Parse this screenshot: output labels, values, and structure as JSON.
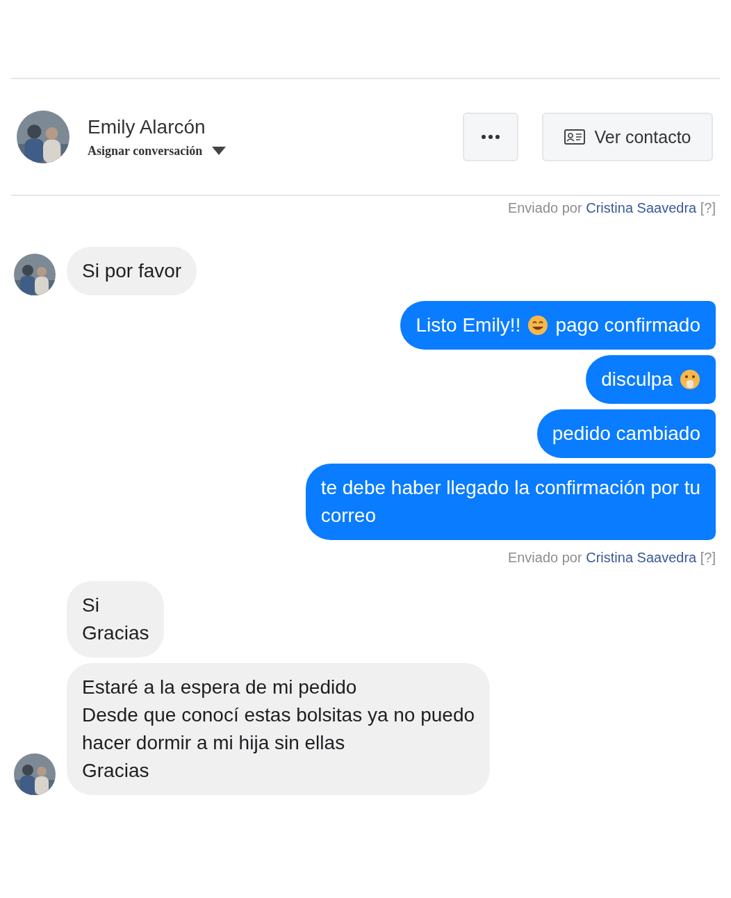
{
  "header": {
    "name": "Emily Alarcón",
    "assign_label": "Asignar conversación",
    "contact_button": "Ver contacto"
  },
  "messages": [
    {
      "kind": "sent_by",
      "prefix": "Enviado por",
      "agent": "Cristina Saavedra",
      "help": "[?]"
    },
    {
      "kind": "incoming",
      "avatar": true,
      "parts": [
        {
          "kind": "text",
          "text": "Si por favor"
        }
      ]
    },
    {
      "kind": "outgoing",
      "parts": [
        {
          "kind": "text",
          "text": "Listo Emily!!"
        },
        {
          "kind": "emoji_grin"
        },
        {
          "kind": "text",
          "text": "pago confirmado"
        }
      ]
    },
    {
      "kind": "outgoing",
      "parts": [
        {
          "kind": "text",
          "text": "disculpa"
        },
        {
          "kind": "emoji_hand_mouth"
        }
      ]
    },
    {
      "kind": "outgoing",
      "parts": [
        {
          "kind": "text",
          "text": "pedido cambiado"
        }
      ]
    },
    {
      "kind": "outgoing",
      "parts": [
        {
          "kind": "text",
          "text": "te debe haber llegado la confirmación por tu\ncorreo"
        }
      ]
    },
    {
      "kind": "sent_by",
      "prefix": "Enviado por",
      "agent": "Cristina Saavedra",
      "help": "[?]"
    },
    {
      "kind": "incoming",
      "avatar": false,
      "parts": [
        {
          "kind": "text",
          "text": "Si\nGracias"
        }
      ]
    },
    {
      "kind": "incoming",
      "avatar": true,
      "parts": [
        {
          "kind": "text",
          "text": "Estaré a la espera de mi pedido\nDesde que conocí estas bolsitas ya no puedo\nhacer dormir a mi hija sin ellas\nGracias"
        }
      ]
    }
  ]
}
